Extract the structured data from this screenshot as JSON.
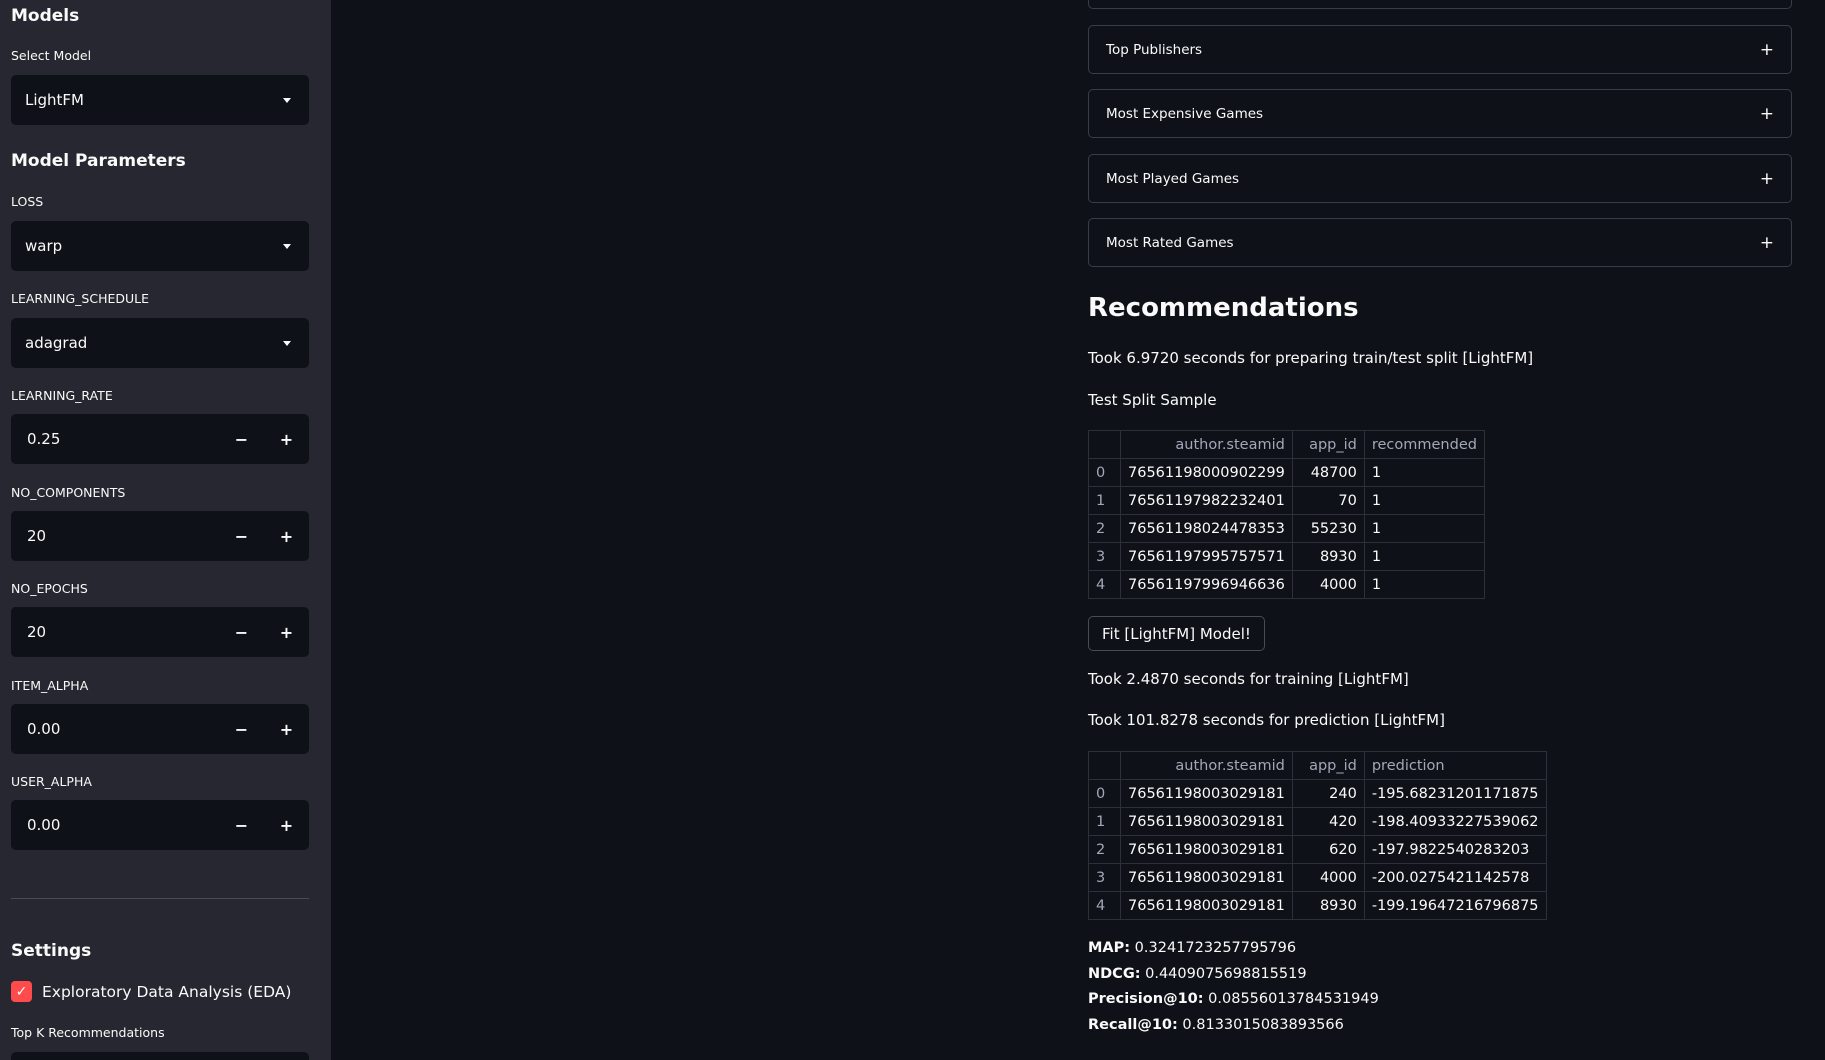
{
  "sidebar": {
    "models_heading": "Models",
    "select_model_label": "Select Model",
    "select_model_value": "LightFM",
    "params_heading": "Model Parameters",
    "loss_label": "LOSS",
    "loss_value": "warp",
    "schedule_label": "LEARNING_SCHEDULE",
    "schedule_value": "adagrad",
    "lr_label": "LEARNING_RATE",
    "lr_value": "0.25",
    "components_label": "NO_COMPONENTS",
    "components_value": "20",
    "epochs_label": "NO_EPOCHS",
    "epochs_value": "20",
    "item_alpha_label": "ITEM_ALPHA",
    "item_alpha_value": "0.00",
    "user_alpha_label": "USER_ALPHA",
    "user_alpha_value": "0.00",
    "minus": "−",
    "plus": "+",
    "settings_heading": "Settings",
    "eda_label": "Exploratory Data Analysis (EDA)",
    "eda_checked": true,
    "topk_label": "Top K Recommendations"
  },
  "main": {
    "expanders": [
      "Top Publishers",
      "Most Expensive Games",
      "Most Played Games",
      "Most Rated Games"
    ],
    "expander_icon": "+",
    "rec_title": "Recommendations",
    "split_time": "Took 6.9720 seconds for preparing train/test split [LightFM]",
    "split_sample_label": "Test Split Sample",
    "split_table": {
      "columns": [
        "",
        "author.steamid",
        "app_id",
        "recommended"
      ],
      "rows": [
        [
          "0",
          "76561198000902299",
          "48700",
          "1"
        ],
        [
          "1",
          "76561197982232401",
          "70",
          "1"
        ],
        [
          "2",
          "76561198024478353",
          "55230",
          "1"
        ],
        [
          "3",
          "76561197995757571",
          "8930",
          "1"
        ],
        [
          "4",
          "76561197996946636",
          "4000",
          "1"
        ]
      ]
    },
    "fit_button": "Fit [LightFM] Model!",
    "train_time": "Took 2.4870 seconds for training [LightFM]",
    "predict_time": "Took 101.8278 seconds for prediction [LightFM]",
    "pred_table": {
      "columns": [
        "",
        "author.steamid",
        "app_id",
        "prediction"
      ],
      "rows": [
        [
          "0",
          "76561198003029181",
          "240",
          "-195.68231201171875"
        ],
        [
          "1",
          "76561198003029181",
          "420",
          "-198.40933227539062"
        ],
        [
          "2",
          "76561198003029181",
          "620",
          "-197.9822540283203"
        ],
        [
          "3",
          "76561198003029181",
          "4000",
          "-200.0275421142578"
        ],
        [
          "4",
          "76561198003029181",
          "8930",
          "-199.19647216796875"
        ]
      ]
    },
    "metrics": [
      {
        "name": "MAP:",
        "value": " 0.3241723257795796"
      },
      {
        "name": "NDCG:",
        "value": " 0.4409075698815519"
      },
      {
        "name": "Precision@10:",
        "value": " 0.08556013784531949"
      },
      {
        "name": "Recall@10:",
        "value": " 0.8133015083893566"
      }
    ]
  },
  "colors": {
    "background": "#0e1117",
    "sidebar": "#262730",
    "accent": "#ff4b4b",
    "text": "#fafafa"
  }
}
